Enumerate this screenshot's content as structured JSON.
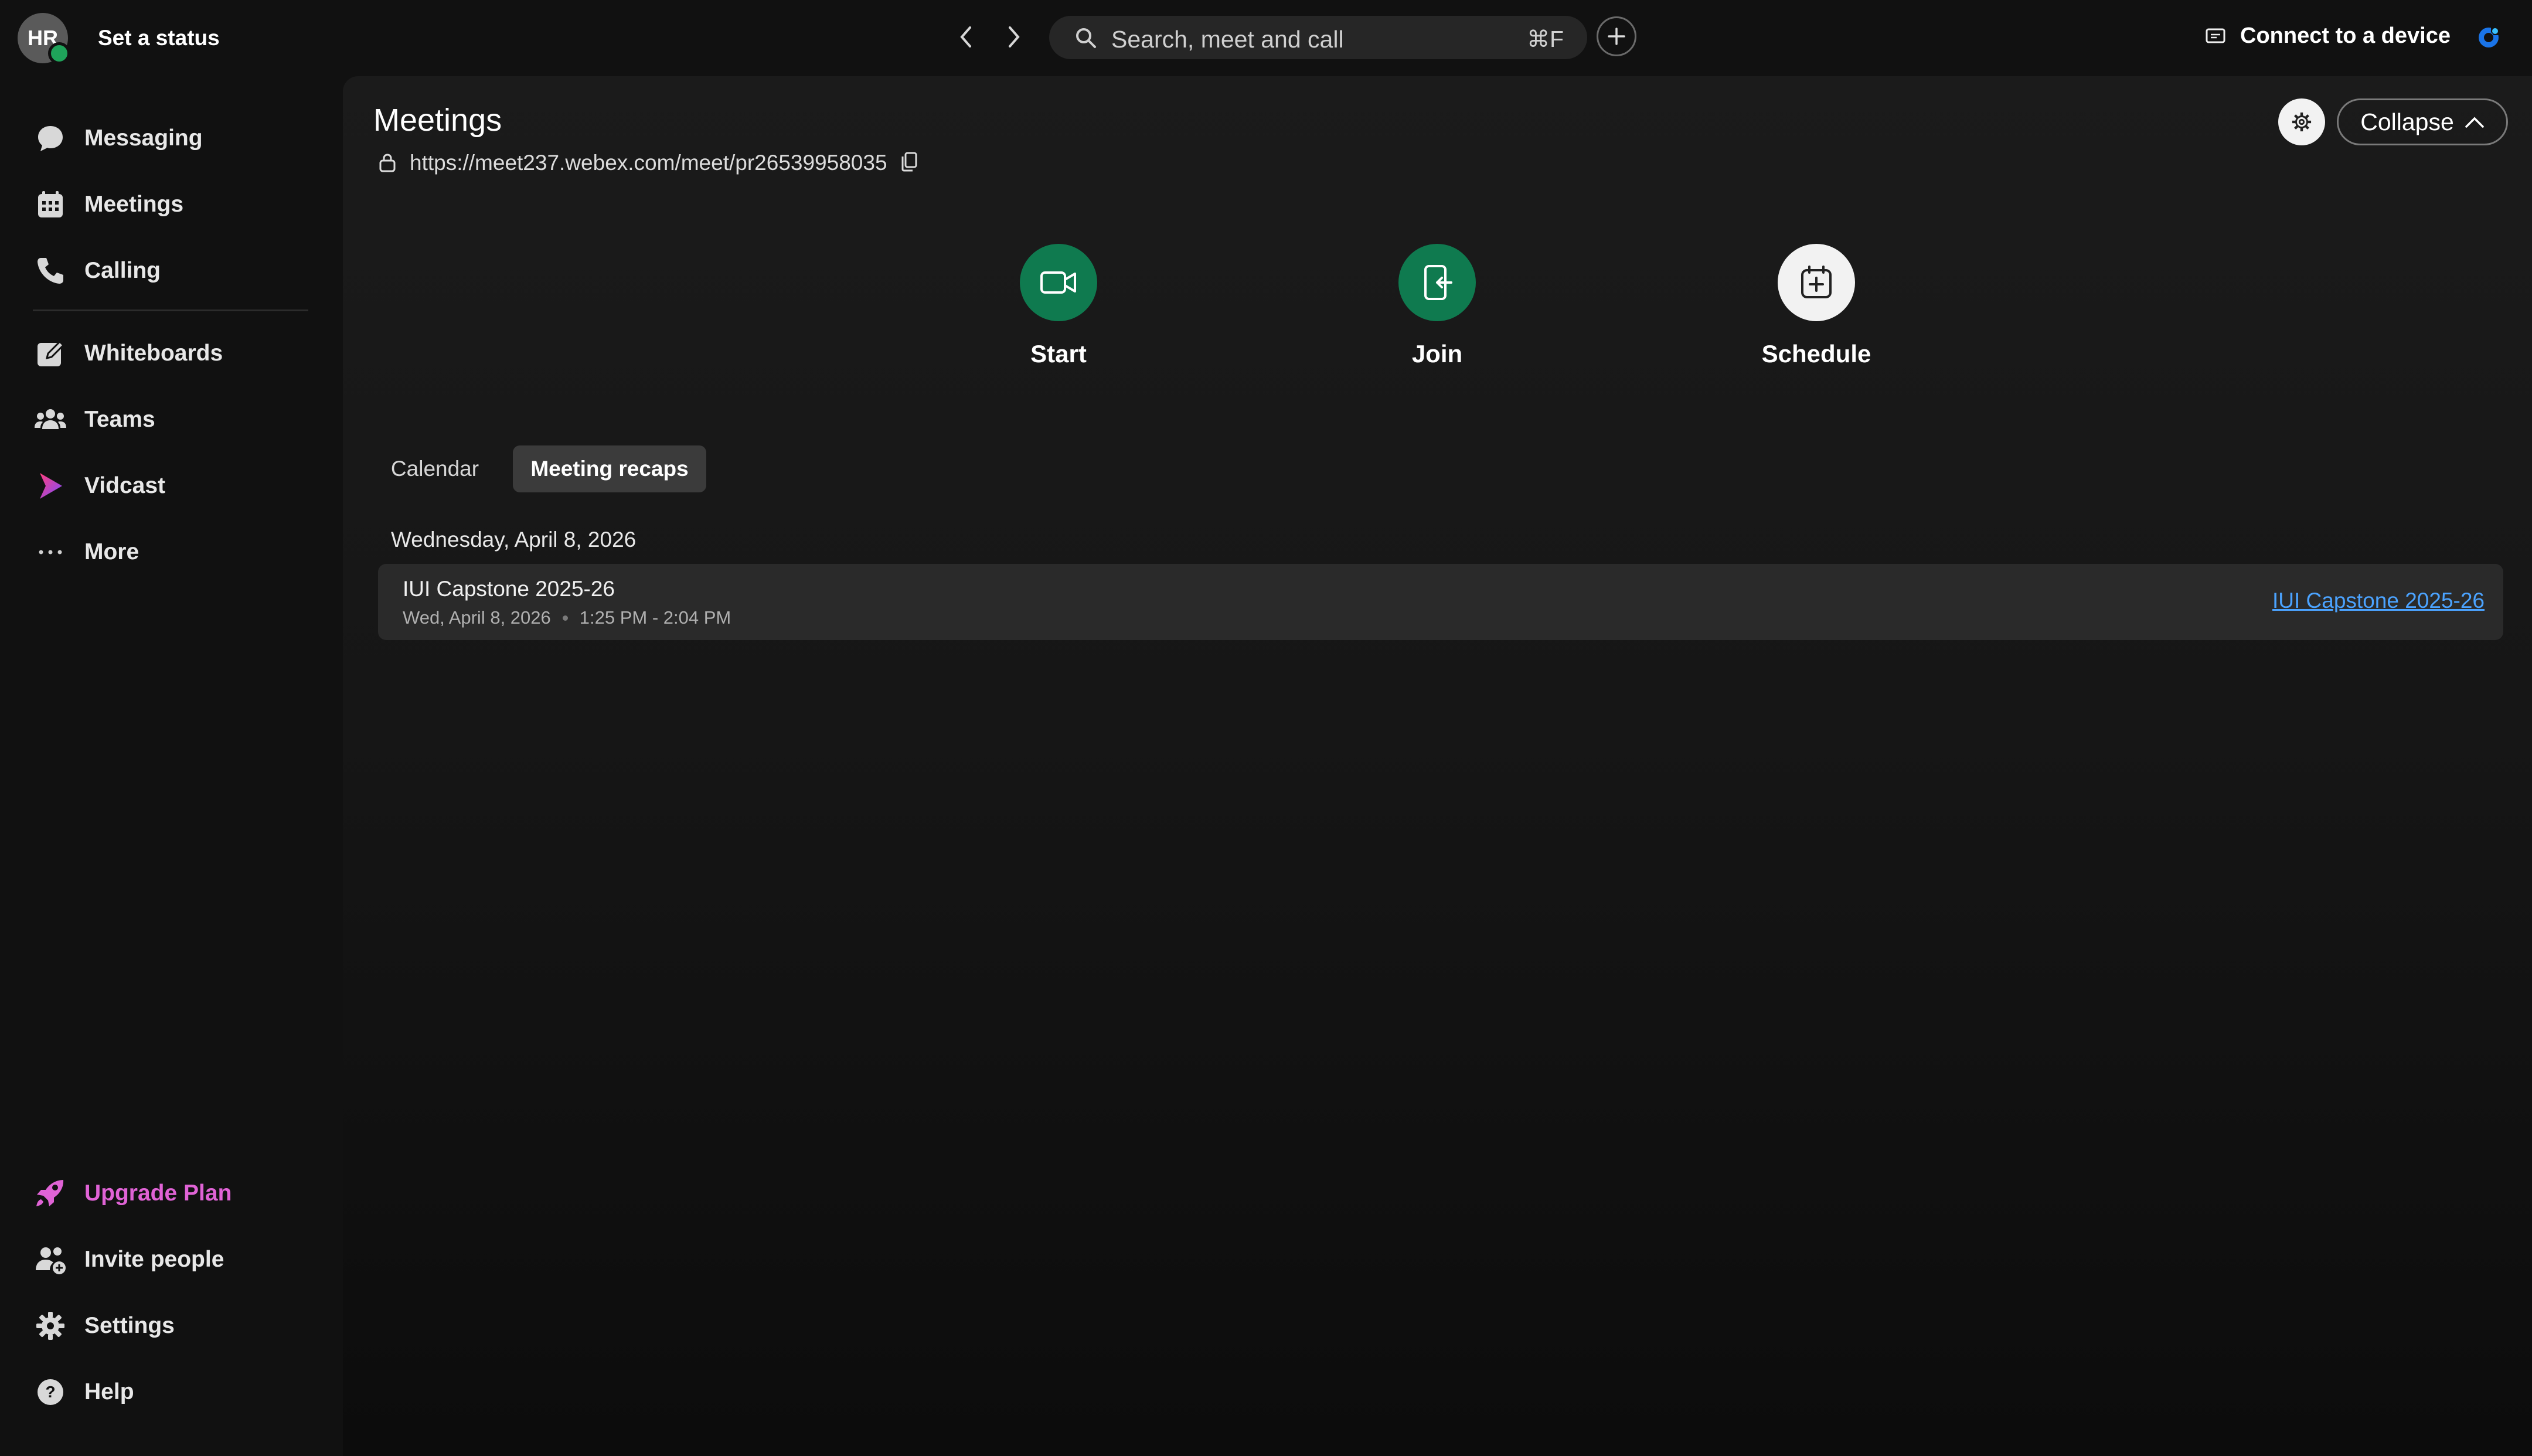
{
  "topbar": {
    "avatar_initials": "HR",
    "status_label": "Set a status",
    "search_placeholder": "Search, meet and call",
    "search_shortcut": "⌘F",
    "connect_label": "Connect to a device"
  },
  "sidebar": {
    "items": [
      {
        "label": "Messaging",
        "icon": "chat-bubble-icon"
      },
      {
        "label": "Meetings",
        "icon": "calendar-icon"
      },
      {
        "label": "Calling",
        "icon": "phone-icon"
      },
      {
        "label": "Whiteboards",
        "icon": "whiteboard-icon"
      },
      {
        "label": "Teams",
        "icon": "people-icon"
      },
      {
        "label": "Vidcast",
        "icon": "vidcast-icon"
      },
      {
        "label": "More",
        "icon": "more-dots-icon"
      }
    ],
    "bottom": [
      {
        "label": "Upgrade Plan",
        "icon": "rocket-icon"
      },
      {
        "label": "Invite people",
        "icon": "invite-people-icon"
      },
      {
        "label": "Settings",
        "icon": "gear-icon"
      },
      {
        "label": "Help",
        "icon": "help-icon"
      }
    ]
  },
  "main": {
    "title": "Meetings",
    "url": "https://meet237.webex.com/meet/pr26539958035",
    "collapse_label": "Collapse",
    "actions": [
      {
        "label": "Start",
        "icon": "video-camera-icon"
      },
      {
        "label": "Join",
        "icon": "join-door-icon"
      },
      {
        "label": "Schedule",
        "icon": "calendar-add-icon"
      }
    ],
    "tabs": [
      {
        "label": "Calendar",
        "active": false
      },
      {
        "label": "Meeting recaps",
        "active": true
      }
    ],
    "date_header": "Wednesday, April 8, 2026",
    "meetings": [
      {
        "title": "IUI Capstone 2025-26",
        "date": "Wed, April 8, 2026",
        "time": "1:25 PM - 2:04 PM",
        "link": "IUI Capstone 2025-26"
      }
    ]
  },
  "colors": {
    "accent_green": "#0f7a4f",
    "upgrade_pink": "#e063d6",
    "link_blue": "#4ba3ff",
    "background": "#111111"
  }
}
